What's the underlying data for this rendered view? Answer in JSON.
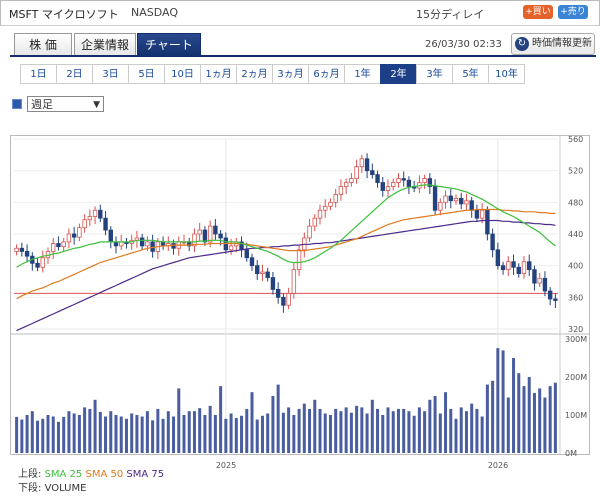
{
  "header": {
    "ticker": "MSFT マイクロソフト",
    "exchange": "NASDAQ",
    "delay": "15分ディレイ",
    "buy_label": "+買い",
    "sell_label": "+売り"
  },
  "tabs": [
    {
      "label": "株 価",
      "active": false
    },
    {
      "label": "企業情報",
      "active": false
    },
    {
      "label": "チャート",
      "active": true
    }
  ],
  "timestamp": "26/03/30 02:33",
  "refresh": {
    "label": "時価情報更新",
    "icon": "refresh-icon"
  },
  "periods": [
    {
      "label": "1日",
      "active": false
    },
    {
      "label": "2日",
      "active": false
    },
    {
      "label": "3日",
      "active": false
    },
    {
      "label": "5日",
      "active": false
    },
    {
      "label": "10日",
      "active": false
    },
    {
      "label": "1ヵ月",
      "active": false
    },
    {
      "label": "2ヵ月",
      "active": false
    },
    {
      "label": "3ヵ月",
      "active": false
    },
    {
      "label": "6ヵ月",
      "active": false
    },
    {
      "label": "1年",
      "active": false
    },
    {
      "label": "2年",
      "active": true
    },
    {
      "label": "3年",
      "active": false
    },
    {
      "label": "5年",
      "active": false
    },
    {
      "label": "10年",
      "active": false
    }
  ],
  "chart_type": {
    "selected": "週足"
  },
  "legend": {
    "upper_label": "上段:",
    "sma25": "SMA 25",
    "sma50": "SMA 50",
    "sma75": "SMA 75",
    "lower_label": "下段:",
    "volume": "VOLUME"
  },
  "colors": {
    "up": "#ffffff",
    "down": "#23427e",
    "candle_outline_up": "#d9534f",
    "sma25": "#3cbf3c",
    "sma50": "#e07a1e",
    "sma75": "#4a2a8a",
    "volume": "#4a5d9e",
    "hline": "#e05050"
  },
  "chart_data": {
    "type": "candlestick",
    "price_axis": {
      "ticks": [
        560,
        520,
        480,
        440,
        400,
        360,
        320
      ],
      "min": 320,
      "max": 560
    },
    "volume_axis": {
      "ticks": [
        "300M",
        "200M",
        "100M",
        "0M"
      ],
      "min": 0,
      "max": 300
    },
    "x_labels": [
      {
        "label": "2025",
        "week": 40
      },
      {
        "label": "2026",
        "week": 92
      }
    ],
    "reference_line": 365,
    "weeks": 104,
    "closes": [
      422,
      418,
      412,
      403,
      398,
      410,
      418,
      428,
      424,
      430,
      440,
      436,
      448,
      458,
      462,
      470,
      460,
      445,
      430,
      425,
      430,
      428,
      432,
      435,
      425,
      430,
      418,
      430,
      425,
      428,
      422,
      430,
      430,
      425,
      440,
      445,
      430,
      450,
      440,
      435,
      420,
      425,
      430,
      420,
      410,
      400,
      390,
      392,
      385,
      370,
      360,
      350,
      365,
      395,
      420,
      435,
      450,
      460,
      470,
      475,
      480,
      490,
      500,
      505,
      510,
      525,
      535,
      520,
      515,
      505,
      495,
      500,
      505,
      510,
      508,
      500,
      498,
      505,
      510,
      500,
      470,
      480,
      488,
      482,
      485,
      478,
      482,
      470,
      460,
      470,
      440,
      420,
      400,
      395,
      405,
      398,
      390,
      405,
      395,
      378,
      384,
      368,
      358,
      356
    ],
    "volumes": [
      95,
      88,
      100,
      110,
      85,
      90,
      100,
      96,
      82,
      95,
      110,
      104,
      100,
      120,
      116,
      140,
      108,
      96,
      110,
      100,
      96,
      90,
      104,
      100,
      96,
      110,
      86,
      116,
      90,
      110,
      96,
      170,
      100,
      110,
      110,
      118,
      100,
      124,
      100,
      176,
      90,
      104,
      92,
      98,
      116,
      160,
      88,
      98,
      104,
      150,
      180,
      106,
      120,
      100,
      116,
      130,
      116,
      140,
      116,
      104,
      100,
      116,
      110,
      120,
      106,
      124,
      120,
      104,
      140,
      116,
      100,
      120,
      110,
      116,
      116,
      110,
      98,
      120,
      110,
      140,
      150,
      104,
      160,
      116,
      90,
      120,
      110,
      130,
      116,
      96,
      180,
      190,
      276,
      270,
      146,
      250,
      210,
      176,
      200,
      158,
      170,
      146,
      176,
      185
    ],
    "sma25": [
      398,
      402,
      405,
      408,
      410,
      412,
      413,
      415,
      416,
      418,
      420,
      422,
      423,
      425,
      427,
      428,
      430,
      430,
      430,
      430,
      430,
      430,
      430,
      432,
      432,
      432,
      432,
      431,
      430,
      430,
      430,
      430,
      430,
      430,
      430,
      431,
      431,
      432,
      432,
      432,
      430,
      430,
      430,
      428,
      426,
      424,
      422,
      420,
      418,
      415,
      412,
      408,
      405,
      404,
      404,
      405,
      407,
      410,
      414,
      418,
      422,
      427,
      432,
      438,
      444,
      450,
      456,
      462,
      468,
      474,
      480,
      486,
      490,
      494,
      497,
      499,
      500,
      501,
      502,
      502,
      501,
      500,
      499,
      498,
      497,
      495,
      493,
      490,
      487,
      484,
      480,
      476,
      472,
      468,
      465,
      462,
      458,
      454,
      450,
      446,
      442,
      436,
      430,
      425
    ],
    "sma50": [
      358,
      362,
      365,
      368,
      370,
      372,
      375,
      378,
      380,
      383,
      386,
      389,
      392,
      395,
      398,
      401,
      404,
      406,
      408,
      410,
      412,
      414,
      416,
      418,
      420,
      422,
      423,
      424,
      425,
      425,
      426,
      426,
      426,
      426,
      427,
      427,
      427,
      428,
      428,
      428,
      428,
      428,
      428,
      428,
      427,
      426,
      425,
      424,
      423,
      422,
      421,
      420,
      419,
      419,
      419,
      419,
      420,
      421,
      422,
      423,
      424,
      426,
      428,
      430,
      432,
      434,
      437,
      440,
      443,
      446,
      449,
      452,
      454,
      456,
      458,
      459,
      460,
      461,
      462,
      463,
      464,
      465,
      466,
      467,
      468,
      469,
      470,
      470,
      471,
      471,
      471,
      471,
      471,
      470,
      470,
      469,
      469,
      468,
      468,
      468,
      467,
      467,
      466,
      466
    ],
    "sma75": [
      318,
      321,
      324,
      327,
      330,
      333,
      336,
      339,
      342,
      345,
      348,
      351,
      354,
      357,
      360,
      363,
      366,
      369,
      372,
      375,
      378,
      381,
      384,
      387,
      390,
      393,
      396,
      398,
      400,
      402,
      404,
      406,
      408,
      410,
      411,
      412,
      413,
      414,
      415,
      416,
      417,
      418,
      419,
      420,
      421,
      422,
      422,
      423,
      423,
      424,
      424,
      425,
      425,
      426,
      426,
      427,
      427,
      428,
      428,
      429,
      429,
      430,
      431,
      432,
      433,
      434,
      435,
      436,
      437,
      438,
      439,
      440,
      441,
      442,
      443,
      444,
      445,
      446,
      447,
      448,
      449,
      450,
      451,
      452,
      453,
      454,
      455,
      456,
      456,
      457,
      457,
      457,
      457,
      456,
      456,
      455,
      455,
      454,
      454,
      453,
      453,
      452,
      452,
      451
    ]
  }
}
